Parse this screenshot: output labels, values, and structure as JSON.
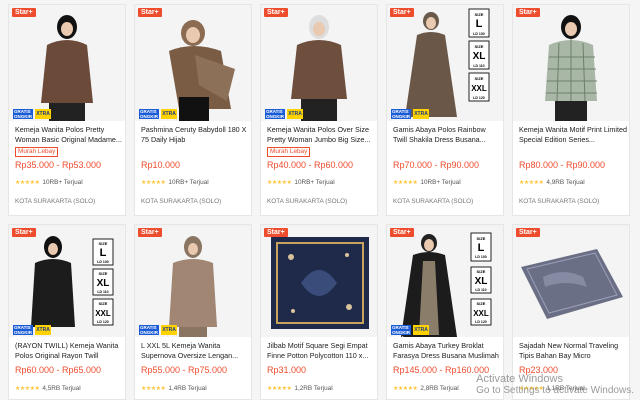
{
  "products": [
    {
      "badge": "Star+",
      "title": "Kemeja Wanita Polos Pretty Woman Basic Original Madame...",
      "tag": "Murah Lebay",
      "price": "Rp35.000 - Rp53.000",
      "rating": "10RB+ Terjual",
      "location": "KOTA SURAKARTA (SOLO)",
      "promo": [
        "GRATIS ONGKIR XTRA",
        "XTRA"
      ]
    },
    {
      "badge": "Star+",
      "title": "Pashmina Ceruty Babydoll 180 X 75 Daily Hijab",
      "tag": "",
      "price": "Rp10.000",
      "rating": "10RB+ Terjual",
      "location": "KOTA SURAKARTA (SOLO)",
      "promo": [
        "GRATIS ONGKIR XTRA",
        "XTRA"
      ]
    },
    {
      "badge": "Star+",
      "title": "Kemeja Wanita Polos Over Size Pretty Woman Jumbo Big Size...",
      "tag": "Murah Lebay",
      "price": "Rp40.000 - Rp60.000",
      "rating": "10RB+ Terjual",
      "location": "KOTA SURAKARTA (SOLO)",
      "promo": [
        "GRATIS ONGKIR XTRA",
        "XTRA"
      ]
    },
    {
      "badge": "Star+",
      "title": "Gamis Abaya Polos Rainbow Twill Shakila Dress Busana...",
      "tag": "",
      "price": "Rp70.000 - Rp90.000",
      "rating": "10RB+ Terjual",
      "location": "KOTA SURAKARTA (SOLO)",
      "promo": [
        "GRATIS ONGKIR XTRA",
        "XTRA"
      ]
    },
    {
      "badge": "Star+",
      "title": "Kemeja Wanita Motif Print Limited Special Edition Series...",
      "tag": "",
      "price": "Rp80.000 - Rp90.000",
      "rating": "4,9RB Terjual",
      "location": "KOTA SURAKARTA (SOLO)",
      "promo": [
        "",
        ""
      ]
    },
    {
      "badge": "Star+",
      "title": "(RAYON TWILL) Kemeja Wanita Polos Original Rayon Twill",
      "tag": "",
      "price": "Rp60.000 - Rp65.000",
      "rating": "4,5RB Terjual",
      "location": "",
      "promo": [
        "GRATIS ONGKIR XTRA",
        "XTRA"
      ]
    },
    {
      "badge": "Star+",
      "title": "L XXL 5L Kemeja Wanita Supernova Oversize Lengan...",
      "tag": "",
      "price": "Rp55.000 - Rp75.000",
      "rating": "1,4RB Terjual",
      "location": "",
      "promo": [
        "GRATIS ONGKIR XTRA",
        "XTRA"
      ]
    },
    {
      "badge": "Star+",
      "title": "Jilbab Motif Square Segi Empat Finne Potton Polycotton 110 x...",
      "tag": "",
      "price": "Rp31.000",
      "rating": "1,2RB Terjual",
      "location": "",
      "promo": [
        "",
        ""
      ]
    },
    {
      "badge": "Star+",
      "title": "Gamis Abaya Turkey Broklat Farasya Dress Busana Muslimah",
      "tag": "",
      "price": "Rp145.000 - Rp160.000",
      "rating": "2,8RB Terjual",
      "location": "",
      "promo": [
        "GRATIS ONGKIR XTRA",
        "XTRA"
      ]
    },
    {
      "badge": "Star+",
      "title": "Sajadah New Normal Traveling Tipis Bahan Bay Micro",
      "tag": "",
      "price": "Rp23.000",
      "rating": "1,1RB Terjual",
      "location": "",
      "promo": [
        "",
        ""
      ]
    }
  ],
  "thumb_text": {
    "brand": "IRTAZA",
    "size_word": "SIZE",
    "sizes": [
      "L",
      "XL",
      "XXL"
    ],
    "size_notes": [
      "LD 100",
      "LD 110",
      "LD 120"
    ]
  },
  "stars": "★★★★★",
  "watermark": {
    "title": "Activate Windows",
    "subtitle": "Go to Settings to activate Windows."
  },
  "colors": {
    "accent": "#ee4d2d",
    "star": "#ffc53d"
  }
}
